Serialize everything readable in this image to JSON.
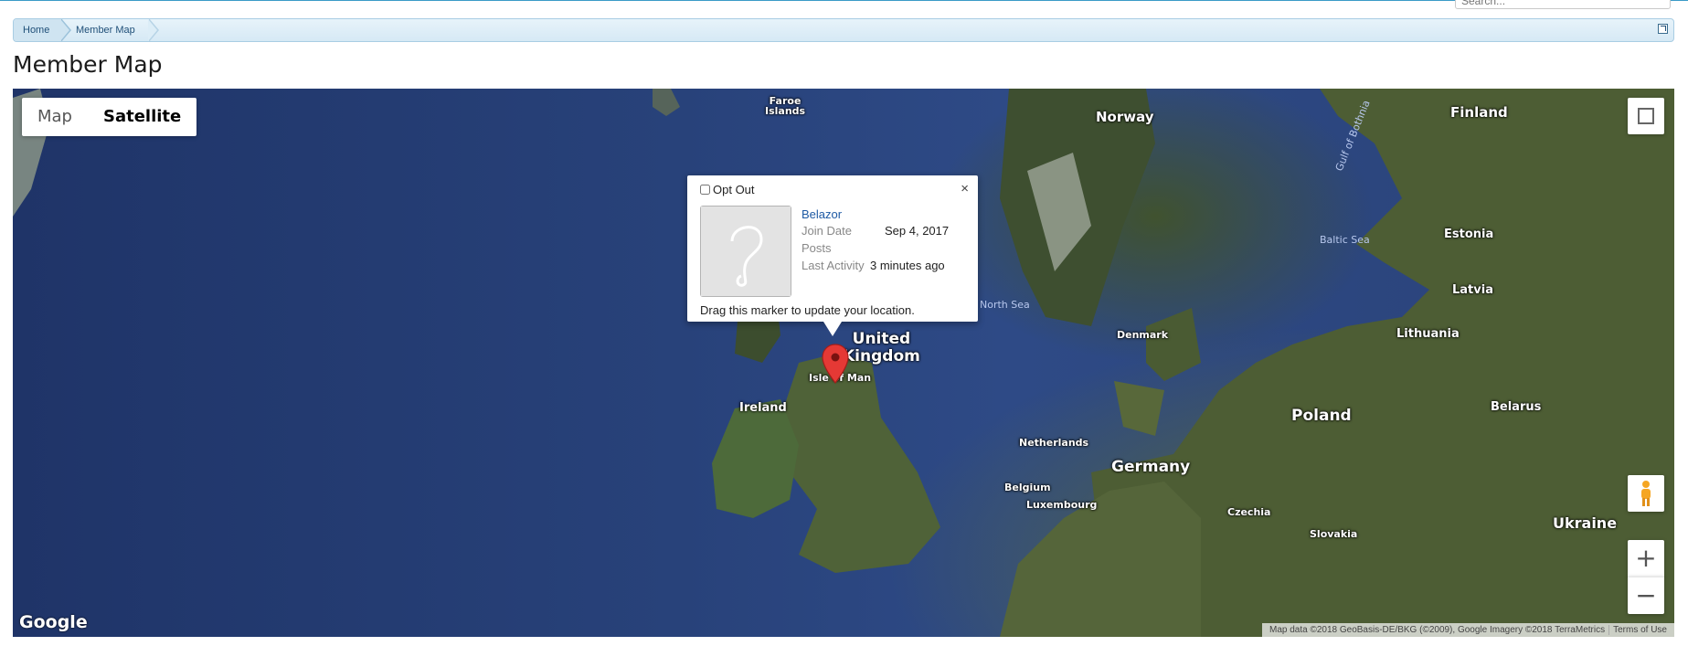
{
  "search": {
    "placeholder": "Search..."
  },
  "breadcrumb": {
    "home": "Home",
    "current": "Member Map"
  },
  "page": {
    "title": "Member Map"
  },
  "map": {
    "type_buttons": [
      "Map",
      "Satellite"
    ],
    "active_type": "Satellite",
    "labels": {
      "faroe": "Faroe\nIslands",
      "norway": "Norway",
      "finland": "Finland",
      "gulf_of_bothnia": "Gulf of Bothnia",
      "estonia": "Estonia",
      "baltic_sea": "Baltic Sea",
      "latvia": "Latvia",
      "north_sea": "North Sea",
      "denmark": "Denmark",
      "lithuania": "Lithuania",
      "uk": "United\nKingdom",
      "isle_of_man": "Isle of Man",
      "ireland": "Ireland",
      "poland": "Poland",
      "belarus": "Belarus",
      "netherlands": "Netherlands",
      "germany": "Germany",
      "belgium": "Belgium",
      "luxembourg": "Luxembourg",
      "czechia": "Czechia",
      "slovakia": "Slovakia",
      "ukraine": "Ukraine"
    },
    "google_logo": "Google",
    "attribution": "Map data ©2018 GeoBasis-DE/BKG (©2009), Google Imagery ©2018 TerraMetrics",
    "terms": "Terms of Use",
    "zoom_in": "+",
    "zoom_out": "−"
  },
  "infowindow": {
    "opt_out": "Opt Out",
    "close": "×",
    "member_name": "Belazor",
    "join_date_label": "Join Date",
    "join_date": "Sep 4, 2017",
    "posts_label": "Posts",
    "posts": "",
    "last_activity_label": "Last Activity",
    "last_activity": "3 minutes ago",
    "drag_note": "Drag this marker to update your location."
  },
  "colors": {
    "marker": "#e53935",
    "link": "#1e5aa4",
    "breadcrumb_border": "#a9cde3"
  }
}
